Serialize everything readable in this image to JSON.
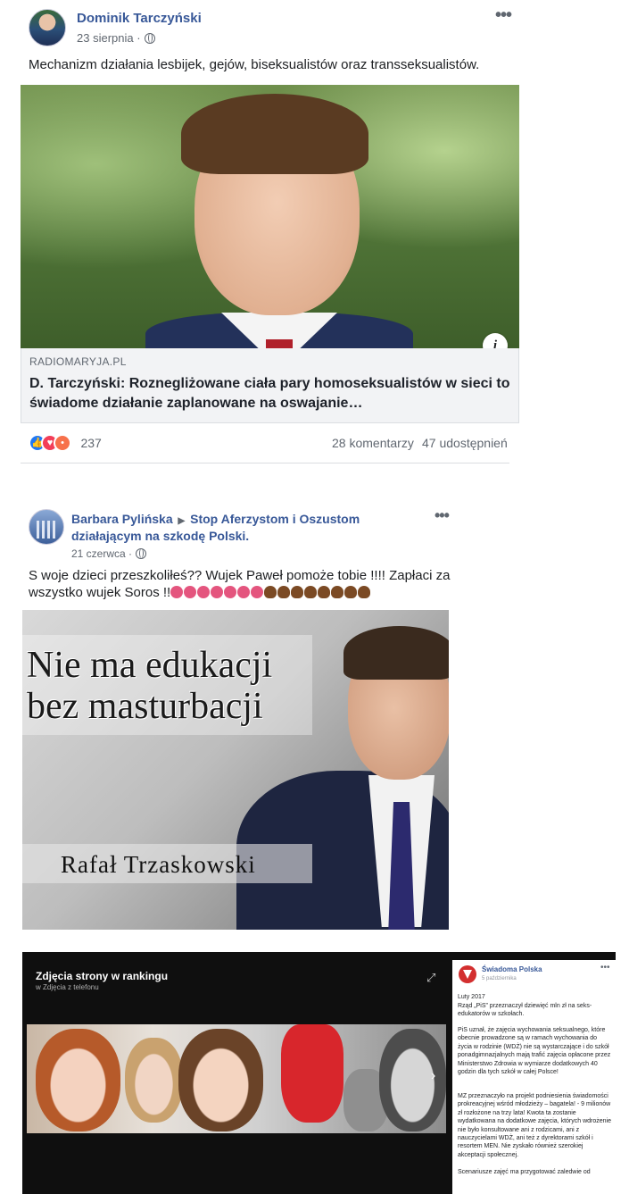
{
  "post1": {
    "author": "Dominik Tarczyński",
    "date": "23 sierpnia",
    "menu": "•••",
    "text": "Mechanizm działania lesbijek, gejów, biseksualistów oraz transseksualistów.",
    "link": {
      "domain": "RADIOMARYJA.PL",
      "headline": "D. Tarczyński: Roznegliżowane ciała pary homoseksualistów w sieci to świadome działanie zaplanowane na oswajanie…"
    },
    "info_icon": "i",
    "reaction_icons": [
      "like-icon",
      "love-icon",
      "angry-icon"
    ],
    "reaction_count": "237",
    "comments": "28 komentarzy",
    "shares": "47 udostępnień"
  },
  "post2": {
    "author": "Barbara Pylińska",
    "arrow": "▶",
    "group_part1": "Stop Aferzystom i Oszustom",
    "group_part2": "działającym na szkodę Polski.",
    "date": "21 czerwca",
    "menu": "•••",
    "text_line1": "S woje dzieci przeszkoliłeś?? Wujek Paweł pomoże tobie !!!! Zapłaci za",
    "text_line2": "wszystko wujek Soros !!",
    "emoji": {
      "devil_count": 7,
      "poo_count": 8
    },
    "image_text": {
      "line1": "Nie ma edukacji",
      "line2": "bez masturbacji",
      "name": "Rafał Trzaskowski"
    }
  },
  "post3": {
    "viewer_title": "Zdjęcia strony w rankingu",
    "viewer_subtitle": "w Zdjęcia z telefonu",
    "expand_icon": "⤢",
    "next_icon": "›",
    "author": "Świadoma Polska",
    "date": "5 października",
    "menu": "•••",
    "paragraphs": [
      "Luty 2017",
      "Rząd „PiS” przeznaczył dziewięć mln zł na seks-edukatorów w szkołach.",
      "PiS uznał, że zajęcia wychowania seksualnego, które obecnie prowadzone są w ramach wychowania do życia w rodzinie (WDŻ) nie są wystarczające i do szkół ponadgimnazjalnych mają trafić zajęcia opłacone przez Ministerstwo Zdrowia w wymiarze dodatkowych 40 godzin dla tych szkół w całej Polsce!",
      "MZ przeznaczyło na projekt podniesienia świadomości prokreacyjnej wśród młodzieży – bagatela! - 9 milionów zł rozłożone na trzy lata! Kwota ta zostanie wydatkowana na dodatkowe zajęcia, których wdrożenie nie było konsultowane ani z rodzicami, ani z nauczycielami WDŻ, ani też z dyrektorami szkół i resortem MEN. Nie zyskało również szerokiej akceptacji społecznej.",
      "Scenariusze zajęć ma przygotować zaledwie od"
    ]
  }
}
